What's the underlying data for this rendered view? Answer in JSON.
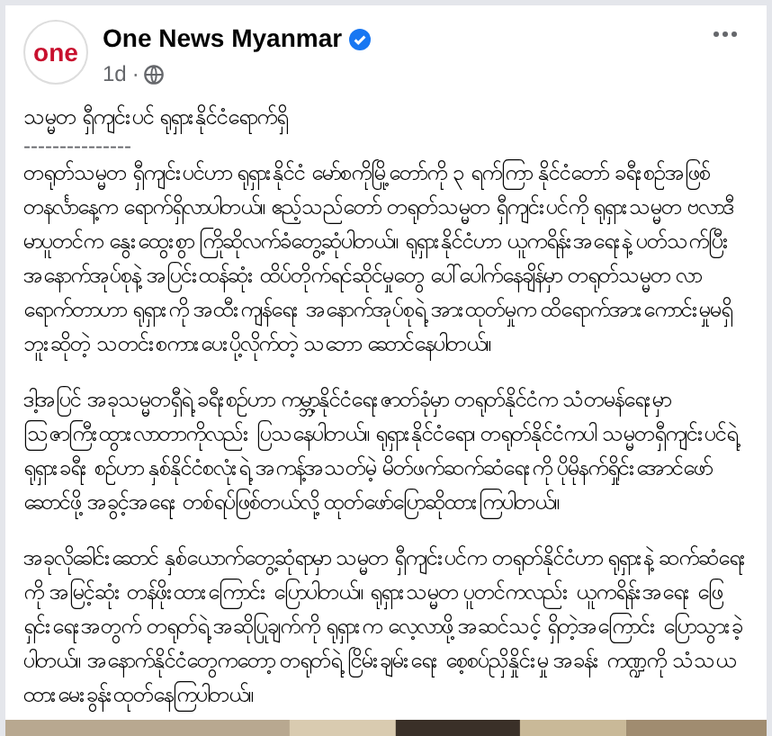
{
  "post": {
    "author": "One News Myanmar",
    "logo_text": "one",
    "verified": true,
    "time": "1d",
    "separator": "·",
    "title": "သမ္မတ ရှီကျင်းပင် ရုရှားနိုင်ငံရောက်ရှိ",
    "divider": "---------------",
    "paragraphs": [
      "တရုတ်သမ္မတ ရှီကျင်းပင်ဟာ ရုရှားနိုင်ငံ မော်စကိုမြို့တော်ကို ၃ ရက်ကြာ နိုင်ငံတော် ခရီးစဉ်အဖြစ် တနင်္လာနေ့က ရောက်ရှိလာပါတယ်။ ဧည့်သည်တော် တရုတ်သမ္မတ ရှီကျင်းပင်ကို ရုရှားသမ္မတ ဗလာဒီမာပူတင်က နွေးထွေးစွာ ကြိုဆိုလက်ခံတွေ့ဆုံပါတယ်။ ရုရှားနိုင်ငံဟာ ယူကရိန်းအရေးနဲ့ ပတ်သက်ပြီး အနောက်အုပ်စုနဲ့ အပြင်းထန်ဆုံး ထိပ်တိုက်ရင်ဆိုင်မှုတွေ ပေါ်ပေါက်နေချိန်မှာ တရုတ်သမ္မတ လာရောက်တာဟာ ရုရှားကို အထီးကျန်ရေး အနောက်အုပ်စုရဲ့ အားထုတ်မှုက ထိရောက်အားကောင်းမှုမရှိဘူးဆိုတဲ့ သတင်းစကားပေးပို့လိုက်တဲ့ သဘော ဆောင်နေပါတယ်။",
      "ဒါ့အပြင် အခုသမ္မတရှီရဲ့ ခရီးစဉ်ဟာ ကမ္ဘာ့နိုင်ငံရေးဇာတ်ခုံမှာ တရုတ်နိုင်ငံက သံတမန်ရေးမှာ ဩဇာကြီးထွားလာတာကိုလည်း ပြသနေပါတယ်။ ရုရှားနိုင်ငံရော၊ တရုတ်နိုင်ငံကပါ သမ္မတရှီကျင်းပင်ရဲ့ ရုရှားခရီး စဉ်ဟာ နှစ်နိုင်ငံစလုံးရဲ့ အကန့်အသတ်မဲ့ မိတ်ဖက်ဆက်ဆံရေးကို ပိုမိုနက်ရှိုင်းအောင်ဖော်ဆောင်ဖို့ အခွင့်အရေး တစ်ရပ်ဖြစ်တယ်လို့ ထုတ်ဖော်ပြောဆိုထားကြပါတယ်။",
      "အခုလိုခေါင်းဆောင် နှစ်ယောက်တွေ့ဆုံရာမှာ သမ္မတ ရှီကျင်းပင်က တရုတ်နိုင်ငံဟာ ရုရှားနဲ့ ဆက်ဆံရေးကို အမြင့်ဆုံး တန်ဖိုးထားကြောင်း ပြောပါတယ်။ ရုရှားသမ္မတ ပူတင်ကလည်း ယူကရိန်းအရေး ဖြေရှင်းရေးအတွက် တရုတ်ရဲ့ အဆိုပြုချက်ကို ရုရှားက လေ့လာဖို့ အဆင်သင့် ရှိတဲ့အကြောင်း ပြောသွားခဲ့ပါတယ်။ အနောက်နိုင်ငံတွေကတော့ တရုတ်ရဲ့ ငြိမ်းချမ်းရေး စေ့စပ်ညှိနှိုင်းမှု အခန်း ကဏ္ဍကို သံသယထားမေးခွန်းထုတ်နေကြပါတယ်။"
    ]
  }
}
